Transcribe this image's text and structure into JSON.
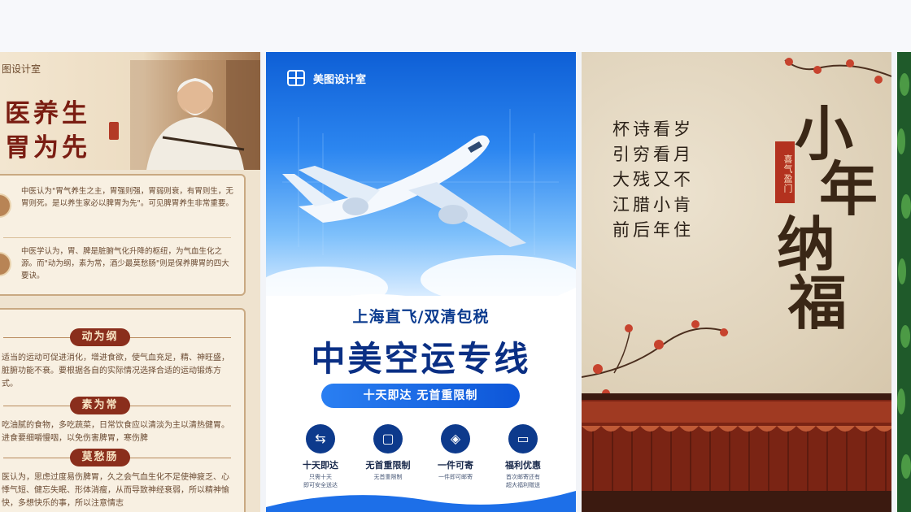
{
  "card1": {
    "brand": "图设计室",
    "title_line1": "医养生",
    "title_line2": "胃为先",
    "intro1": "中医认为\"胃气养生之主，胃强则强，胃弱则衰，有胃则生，无胃则死。是以养生家必以脾胃为先\"。可见脾胃养生非常重要。",
    "intro2": "中医学认为，胃、脾是脏腑气化升降的枢纽，为气血生化之源。而\"动为纲，素为常，酒少最莫愁肠\"则是保养脾胃的四大要诀。",
    "sections": [
      {
        "tag": "动为纲",
        "text": "适当的运动可促进消化，增进食欲，使气血充足，精、神旺盛，脏腑功能不衰。要根据各自的实际情况选择合适的运动锻炼方式。"
      },
      {
        "tag": "素为常",
        "text": "吃油腻的食物，多吃蔬菜，日常饮食应以清淡为主以清热健胃。进食要细嚼慢咽，以免伤害脾胃，寒伤脾"
      },
      {
        "tag": "莫愁肠",
        "text": "医认为，思虑过度易伤脾胃，久之会气血生化不足使神疲乏、心悸气短、健忘失眠、形体消瘦，从而导致神经衰弱，所以精神愉快，多想快乐的事，所以注意情志"
      }
    ]
  },
  "card2": {
    "brand": "美图设计室",
    "subtitle": "上海直飞/双清包税",
    "title": "中美空运专线",
    "pill": "十天即达  无首重限制",
    "features": [
      {
        "icon": "truck-icon",
        "glyph": "🚚",
        "label": "十天即达",
        "desc": "只需十天\n即可安全送达"
      },
      {
        "icon": "box-icon",
        "glyph": "▢",
        "label": "无首重限制",
        "desc": "无首重限制"
      },
      {
        "icon": "package-icon",
        "glyph": "◈",
        "label": "一件可寄",
        "desc": "一件即可邮寄"
      },
      {
        "icon": "ticket-icon",
        "glyph": "▭",
        "label": "福利优惠",
        "desc": "首次邮寄还有\n超大福利赠送"
      }
    ],
    "colors": {
      "primary": "#0a2f84",
      "accent": "#1463e0"
    }
  },
  "card3": {
    "poem": [
      "杯诗看岁",
      "引穷看月",
      "大残又不",
      "江腊小肯",
      "前后年住"
    ],
    "title_chars": [
      "小",
      "年",
      "纳",
      "福"
    ],
    "seal": "喜气盈门",
    "colors": {
      "ink": "#3a2716",
      "seal": "#b3321f",
      "roof": "#7a2414"
    }
  }
}
